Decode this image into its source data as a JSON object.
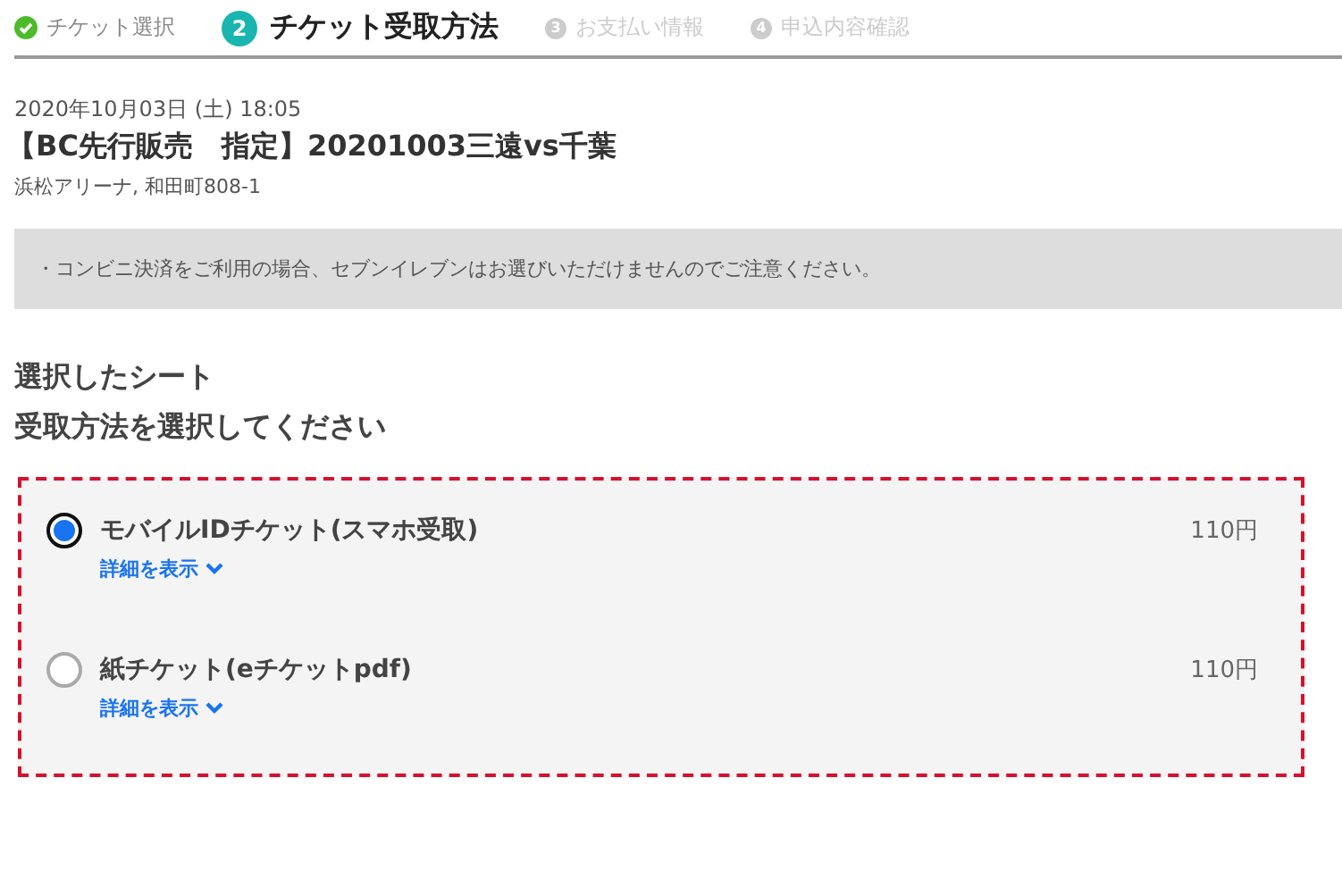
{
  "steps": [
    {
      "kind": "done",
      "label": "チケット選択"
    },
    {
      "kind": "current",
      "number": "2",
      "label": "チケット受取方法"
    },
    {
      "kind": "upcoming",
      "number": "3",
      "label": "お支払い情報"
    },
    {
      "kind": "upcoming",
      "number": "4",
      "label": "申込内容確認"
    }
  ],
  "event": {
    "datetime": "2020年10月03日 (土) 18:05",
    "title": "【BC先行販売　指定】20201003三遠vs千葉",
    "venue": "浜松アリーナ, 和田町808-1"
  },
  "notice": "・コンビニ決済をご利用の場合、セブンイレブンはお選びいただけませんのでご注意ください。",
  "headings": [
    "選択したシート",
    "受取方法を選択してください"
  ],
  "options": [
    {
      "label": "モバイルIDチケット(スマホ受取)",
      "price": "110円",
      "details_link": "詳細を表示",
      "selected": true
    },
    {
      "label": "紙チケット(eチケットpdf)",
      "price": "110円",
      "details_link": "詳細を表示",
      "selected": false
    }
  ]
}
